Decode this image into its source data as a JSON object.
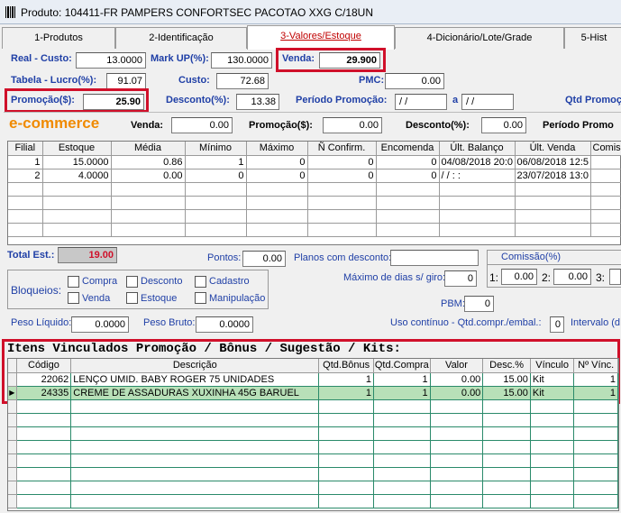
{
  "window": {
    "title": "Produto: 104411-FR PAMPERS CONFORTSEC PACOTAO XXG C/18UN"
  },
  "tabs": [
    {
      "label": "1-Produtos"
    },
    {
      "label": "2-Identificação"
    },
    {
      "label": "3-Valores/Estoque",
      "active": true
    },
    {
      "label": "4-Dicionário/Lote/Grade"
    },
    {
      "label": "5-Hist"
    }
  ],
  "prices": {
    "real_custo_label": "Real - Custo:",
    "real_custo": "13.0000",
    "markup_label": "Mark UP(%):",
    "markup": "130.0000",
    "venda_label": "Venda:",
    "venda": "29.900",
    "tabela_lucro_label": "Tabela - Lucro(%):",
    "tabela_lucro": "91.07",
    "custo_label": "Custo:",
    "custo": "72.68",
    "pmc_label": "PMC:",
    "pmc": "0.00",
    "promocao_label": "Promoção($):",
    "promocao": "25.90",
    "desconto_label": "Desconto(%):",
    "desconto": "13.38",
    "periodo_label": "Período Promoção:",
    "periodo_ini": " / /",
    "periodo_sep": "a",
    "periodo_fim": " / /",
    "qtd_promo_label": "Qtd Promoç"
  },
  "ecommerce": {
    "logo": "e-commerce",
    "venda_label": "Venda:",
    "venda": "0.00",
    "promocao_label": "Promoção($):",
    "promocao": "0.00",
    "desconto_label": "Desconto(%):",
    "desconto": "0.00",
    "periodo_label": "Período Promo"
  },
  "stock_table": {
    "columns": [
      "Filial",
      "Estoque",
      "Média",
      "Mínimo",
      "Máximo",
      "Ñ Confirm.",
      "Encomenda",
      "Últ. Balanço",
      "Últ. Venda",
      "Comis. C"
    ],
    "rows": [
      [
        "1",
        "15.0000",
        "0.86",
        "1",
        "0",
        "0",
        "0",
        "04/08/2018 20:0",
        "06/08/2018 12:5",
        ""
      ],
      [
        "2",
        "4.0000",
        "0.00",
        "0",
        "0",
        "0",
        "0",
        "/ /  :  :",
        "23/07/2018 13:0",
        ""
      ]
    ]
  },
  "totals": {
    "total_est_label": "Total Est.:",
    "total_est": "19.00",
    "pontos_label": "Pontos:",
    "pontos": "0.00",
    "planos_label": "Planos com desconto:",
    "comissao_label": "Comissão(%)",
    "max_dias_label": "Máximo de dias s/ giro:",
    "max_dias": "0",
    "c1_label": "1:",
    "c1": "0.00",
    "c2_label": "2:",
    "c2": "0.00",
    "c3_label": "3:",
    "pbm_label": "PBM:",
    "pbm": "0",
    "peso_liq_label": "Peso Líquido:",
    "peso_liq": "0.0000",
    "peso_bruto_label": "Peso Bruto:",
    "peso_bruto": "0.0000",
    "uso_label": "Uso contínuo - Qtd.compr./embal.:",
    "uso": "0",
    "intervalo_label": "Intervalo (d"
  },
  "bloqueios": {
    "label": "Bloqueios:",
    "items": [
      "Compra",
      "Desconto",
      "Cadastro",
      "Venda",
      "Estoque",
      "Manipulação"
    ]
  },
  "kits": {
    "title": "Itens Vinculados Promoção / Bônus / Sugestão / Kits:",
    "columns": [
      "Código",
      "Descrição",
      "Qtd.Bônus",
      "Qtd.Compra",
      "Valor",
      "Desc.%",
      "Vínculo",
      "Nº Vínc."
    ],
    "rows": [
      [
        "22062",
        "LENÇO UMID. BABY ROGER 75 UNIDADES",
        "1",
        "1",
        "0.00",
        "15.00",
        "Kit",
        "1"
      ],
      [
        "24335",
        "CREME DE ASSADURAS XUXINHA 45G BARUEL",
        "1",
        "1",
        "0.00",
        "15.00",
        "Kit",
        "1"
      ]
    ]
  },
  "colors": {
    "highlight": "#d0102a",
    "label_blue": "#1f3fa6",
    "ecommerce_orange": "#f08a00",
    "selected_row": "#b8e0b8"
  }
}
